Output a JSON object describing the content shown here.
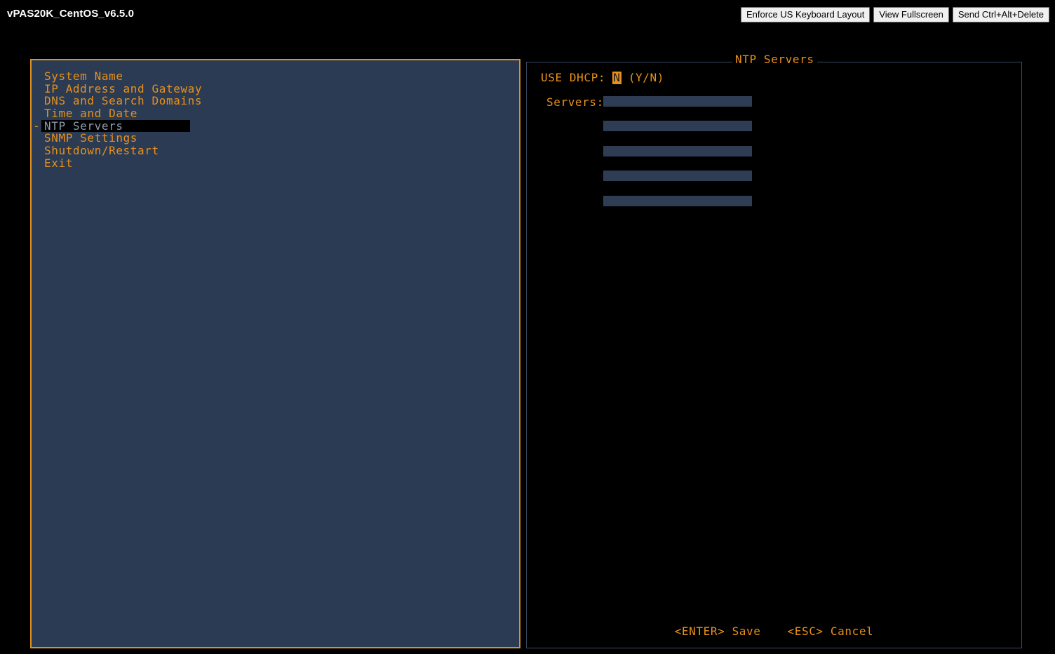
{
  "window": {
    "title": "vPAS20K_CentOS_v6.5.0"
  },
  "toolbar": {
    "buttons": [
      {
        "label": "Enforce US Keyboard Layout",
        "name": "enforce-us-keyboard-layout-button"
      },
      {
        "label": "View Fullscreen",
        "name": "view-fullscreen-button"
      },
      {
        "label": "Send Ctrl+Alt+Delete",
        "name": "send-ctrl-alt-delete-button"
      }
    ]
  },
  "menu": {
    "selected_index": 4,
    "cursor_marker": "-",
    "items": [
      {
        "label": "System Name"
      },
      {
        "label": "IP Address and Gateway"
      },
      {
        "label": "DNS and Search Domains"
      },
      {
        "label": "Time and Date"
      },
      {
        "label": "NTP Servers"
      },
      {
        "label": "SNMP Settings"
      },
      {
        "label": "Shutdown/Restart"
      },
      {
        "label": "Exit"
      }
    ]
  },
  "panel": {
    "title": "NTP Servers",
    "dhcp": {
      "label": "USE DHCP:",
      "value": "N",
      "hint": "(Y/N)"
    },
    "servers": {
      "label": "Servers:",
      "values": [
        "",
        "",
        "",
        "",
        ""
      ]
    },
    "actions": [
      {
        "label": "<ENTER> Save",
        "name": "save-action"
      },
      {
        "label": "<ESC> Cancel",
        "name": "cancel-action"
      }
    ]
  },
  "colors": {
    "accent_orange": "#e8901a",
    "panel_blue": "#2b3b53",
    "field_blue": "#2e3d54",
    "background_black": "#000000",
    "selected_text": "#8f9bab",
    "right_border": "#3a4a63"
  }
}
